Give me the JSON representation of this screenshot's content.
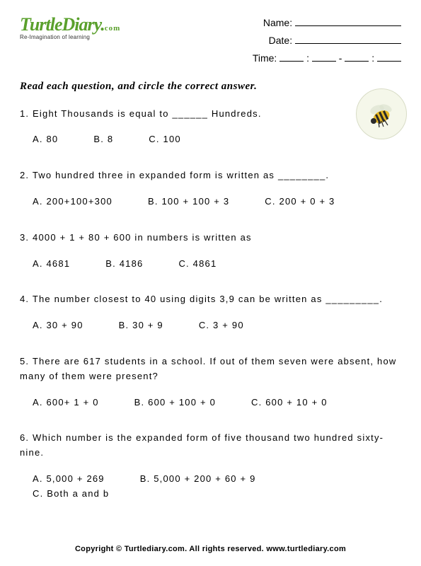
{
  "logo": {
    "text": "TurtleDiary",
    "suffix": ".com",
    "tagline": "Re-Imagination of learning"
  },
  "meta": {
    "name_label": "Name:",
    "date_label": "Date:",
    "time_label": "Time:"
  },
  "instructions": "Read each question, and circle the correct answer.",
  "questions": [
    {
      "num": "1.",
      "text": "Eight Thousands is equal to ______ Hundreds.",
      "choices": [
        {
          "label": "A.",
          "text": "80"
        },
        {
          "label": "B.",
          "text": "8"
        },
        {
          "label": "C.",
          "text": "100"
        }
      ]
    },
    {
      "num": "2.",
      "text": "Two hundred three in expanded form is written as ________.",
      "choices": [
        {
          "label": "A.",
          "text": "200+100+300"
        },
        {
          "label": "B.",
          "text": "100 + 100 + 3"
        },
        {
          "label": "C.",
          "text": "200 + 0 + 3"
        }
      ]
    },
    {
      "num": "3.",
      "text": "4000 + 1 + 80 + 600 in numbers is written as",
      "choices": [
        {
          "label": "A.",
          "text": "4681"
        },
        {
          "label": "B.",
          "text": "4186"
        },
        {
          "label": "C.",
          "text": "4861"
        }
      ]
    },
    {
      "num": "4.",
      "text": "The number closest to 40 using digits 3,9 can be written as _________.",
      "choices": [
        {
          "label": "A.",
          "text": "30 + 90"
        },
        {
          "label": "B.",
          "text": "30 + 9"
        },
        {
          "label": "C.",
          "text": "3 + 90"
        }
      ]
    },
    {
      "num": "5.",
      "text": "There are 617 students in a school. If out of them seven were absent, how many of them were present?",
      "choices": [
        {
          "label": "A.",
          "text": "600+ 1 + 0"
        },
        {
          "label": "B.",
          "text": "600 + 100 + 0"
        },
        {
          "label": "C.",
          "text": "600 + 10 + 0"
        }
      ]
    },
    {
      "num": "6.",
      "text": "Which number is the expanded form of five thousand two hundred sixty-nine.",
      "choices": [
        {
          "label": "A.",
          "text": "5,000 + 269"
        },
        {
          "label": "B.",
          "text": "5,000 + 200 + 60 + 9"
        },
        {
          "label": "C.",
          "text": "Both a and b"
        }
      ]
    }
  ],
  "footer": "Copyright © Turtlediary.com. All rights reserved. www.turtlediary.com"
}
